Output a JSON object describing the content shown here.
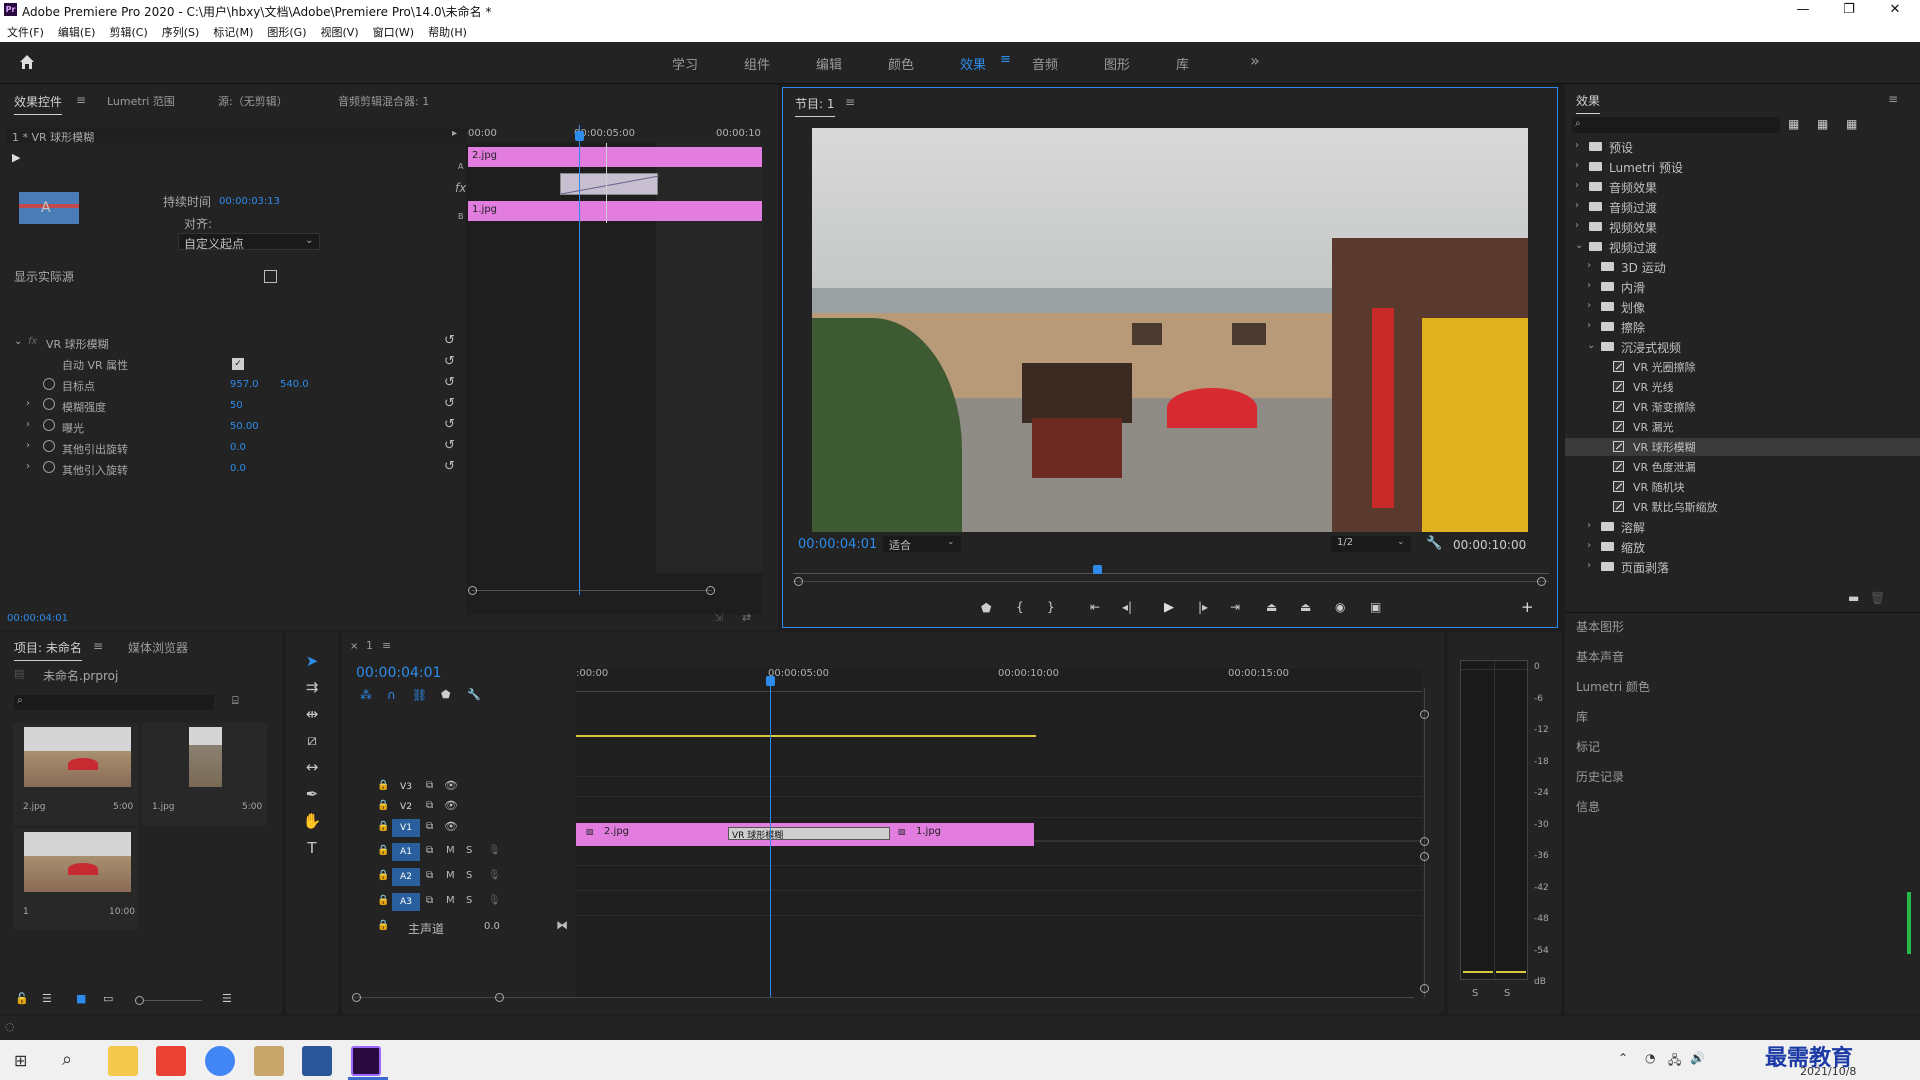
{
  "window": {
    "title": "Adobe Premiere Pro 2020 - C:\\用户\\hbxy\\文档\\Adobe\\Premiere Pro\\14.0\\未命名 *",
    "logo": "Pr",
    "minimize": "—",
    "maximize": "❐",
    "close": "✕"
  },
  "menu": [
    "文件(F)",
    "编辑(E)",
    "剪辑(C)",
    "序列(S)",
    "标记(M)",
    "图形(G)",
    "视图(V)",
    "窗口(W)",
    "帮助(H)"
  ],
  "workspaces": [
    "学习",
    "组件",
    "编辑",
    "颜色",
    "效果",
    "音频",
    "图形",
    "库"
  ],
  "workspace_more": "»",
  "effect_controls": {
    "tabs": [
      "效果控件",
      "Lumetri 范围",
      "源:（无剪辑）",
      "音频剪辑混合器: 1"
    ],
    "clip_name": "1 * VR 球形模糊",
    "duration_label": "持续时间",
    "duration_value": "00:00:03:13",
    "align_label": "对齐:",
    "align_value": "自定义起点",
    "show_source_label": "显示实际源",
    "ruler": [
      "00:00",
      "00:00:05:00",
      "00:00:10"
    ],
    "track_a_label": "A",
    "track_b_label": "B",
    "fx_label": "fx",
    "clip_a": "2.jpg",
    "clip_b": "1.jpg",
    "effect_name": "VR 球形模糊",
    "params": [
      {
        "name": "自动 VR 属性",
        "value": ""
      },
      {
        "name": "目标点",
        "value": "957.0",
        "value2": "540.0"
      },
      {
        "name": "模糊强度",
        "value": "50"
      },
      {
        "name": "曝光",
        "value": "50.00"
      },
      {
        "name": "其他引出旋转",
        "value": "0.0"
      },
      {
        "name": "其他引入旋转",
        "value": "0.0"
      }
    ],
    "current_time": "00:00:04:01"
  },
  "program_monitor": {
    "title": "节目: 1",
    "timecode": "00:00:04:01",
    "fit_label": "适合",
    "resolution": "1/2",
    "duration": "00:00:10:00"
  },
  "effects_panel": {
    "title": "效果",
    "search_placeholder": "",
    "tree": [
      {
        "label": "预设",
        "level": 0,
        "open": false,
        "type": "folder"
      },
      {
        "label": "Lumetri 预设",
        "level": 0,
        "open": false,
        "type": "folder"
      },
      {
        "label": "音频效果",
        "level": 0,
        "open": false,
        "type": "folder"
      },
      {
        "label": "音频过渡",
        "level": 0,
        "open": false,
        "type": "folder"
      },
      {
        "label": "视频效果",
        "level": 0,
        "open": false,
        "type": "folder"
      },
      {
        "label": "视频过渡",
        "level": 0,
        "open": true,
        "type": "folder"
      },
      {
        "label": "3D 运动",
        "level": 1,
        "open": false,
        "type": "folder"
      },
      {
        "label": "内滑",
        "level": 1,
        "open": false,
        "type": "folder"
      },
      {
        "label": "划像",
        "level": 1,
        "open": false,
        "type": "folder"
      },
      {
        "label": "擦除",
        "level": 1,
        "open": false,
        "type": "folder"
      },
      {
        "label": "沉浸式视频",
        "level": 1,
        "open": true,
        "type": "folder"
      },
      {
        "label": "VR 光圈擦除",
        "level": 2,
        "type": "effect"
      },
      {
        "label": "VR 光线",
        "level": 2,
        "type": "effect"
      },
      {
        "label": "VR 渐变擦除",
        "level": 2,
        "type": "effect"
      },
      {
        "label": "VR 漏光",
        "level": 2,
        "type": "effect"
      },
      {
        "label": "VR 球形模糊",
        "level": 2,
        "type": "effect",
        "selected": true
      },
      {
        "label": "VR 色度泄漏",
        "level": 2,
        "type": "effect"
      },
      {
        "label": "VR 随机块",
        "level": 2,
        "type": "effect"
      },
      {
        "label": "VR 默比乌斯缩放",
        "level": 2,
        "type": "effect"
      },
      {
        "label": "溶解",
        "level": 1,
        "open": false,
        "type": "folder"
      },
      {
        "label": "缩放",
        "level": 1,
        "open": false,
        "type": "folder"
      },
      {
        "label": "页面剥落",
        "level": 1,
        "open": false,
        "type": "folder"
      }
    ],
    "collapsed_panels": [
      "基本图形",
      "基本声音",
      "Lumetri 颜色",
      "库",
      "标记",
      "历史记录",
      "信息"
    ]
  },
  "project_panel": {
    "tabs": [
      "项目: 未命名",
      "媒体浏览器"
    ],
    "file": "未命名.prproj",
    "items": [
      {
        "name": "2.jpg",
        "duration": "5:00"
      },
      {
        "name": "1.jpg",
        "duration": "5:00"
      },
      {
        "name": "1",
        "duration": "10:00"
      }
    ]
  },
  "timeline": {
    "tab": "1",
    "timecode": "00:00:04:01",
    "ruler": [
      ":00:00",
      "00:00:05:00",
      "00:00:10:00",
      "00:00:15:00"
    ],
    "video_tracks": [
      "V3",
      "V2",
      "V1"
    ],
    "audio_tracks": [
      "A1",
      "A2",
      "A3"
    ],
    "master_label": "主声道",
    "master_value": "0.0",
    "clip_1": "2.jpg",
    "transition": "VR 球形模糊",
    "clip_2": "1.jpg",
    "mute": "M",
    "solo": "S"
  },
  "audio_meter": {
    "labels": [
      "0",
      "-6",
      "-12",
      "-18",
      "-24",
      "-30",
      "-36",
      "-42",
      "-48",
      "-54",
      "dB"
    ],
    "solo_l": "S",
    "solo_r": "S"
  },
  "taskbar": {
    "date": "2021/10/8",
    "brand": "最需教育"
  },
  "colors": {
    "accent": "#2d8ceb",
    "clip": "#e27cdf",
    "panel": "#232323",
    "background": "#1d1d1d"
  }
}
